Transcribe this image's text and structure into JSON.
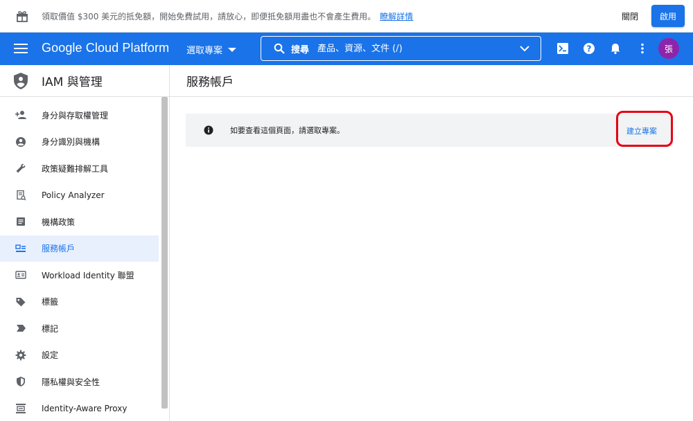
{
  "promo": {
    "text": "領取價值 $300 美元的抵免額，開始免費試用，請放心，即便抵免額用盡也不會產生費用。",
    "link": "瞭解詳情",
    "dismiss_label": "關閉",
    "activate_label": "啟用",
    "icon": "gift-icon"
  },
  "appbar": {
    "brand": "Google Cloud Platform",
    "project_selector": "選取專案",
    "search_label": "搜尋",
    "search_placeholder": "產品、資源、文件 (/)",
    "avatar_initial": "張",
    "colors": {
      "primary": "#1a73e8",
      "avatar": "#8e24aa"
    },
    "icons": [
      "menu-icon",
      "search-icon",
      "chevron-down-icon",
      "cloud-shell-icon",
      "help-icon",
      "notifications-icon",
      "more-vert-icon"
    ]
  },
  "sidebar": {
    "title": "IAM 與管理",
    "items": [
      {
        "label": "身分與存取權管理",
        "icon": "person-add-icon",
        "active": false
      },
      {
        "label": "身分識別與機構",
        "icon": "account-circle-icon",
        "active": false
      },
      {
        "label": "政策疑難排解工具",
        "icon": "wrench-icon",
        "active": false
      },
      {
        "label": "Policy Analyzer",
        "icon": "policy-analyzer-icon",
        "active": false
      },
      {
        "label": "機構政策",
        "icon": "list-icon",
        "active": false
      },
      {
        "label": "服務帳戶",
        "icon": "service-account-icon",
        "active": true
      },
      {
        "label": "Workload Identity 聯盟",
        "icon": "id-card-icon",
        "active": false
      },
      {
        "label": "標籤",
        "icon": "tag-icon",
        "active": false
      },
      {
        "label": "標記",
        "icon": "label-icon",
        "active": false
      },
      {
        "label": "設定",
        "icon": "gear-icon",
        "active": false
      },
      {
        "label": "隱私權與安全性",
        "icon": "shield-icon",
        "active": false
      },
      {
        "label": "Identity-Aware Proxy",
        "icon": "proxy-icon",
        "active": false
      }
    ]
  },
  "main": {
    "page_title": "服務帳戶",
    "notice_text": "如要查看這個頁面，請選取專案。",
    "create_label": "建立專案",
    "highlight_color": "#e6000f"
  }
}
